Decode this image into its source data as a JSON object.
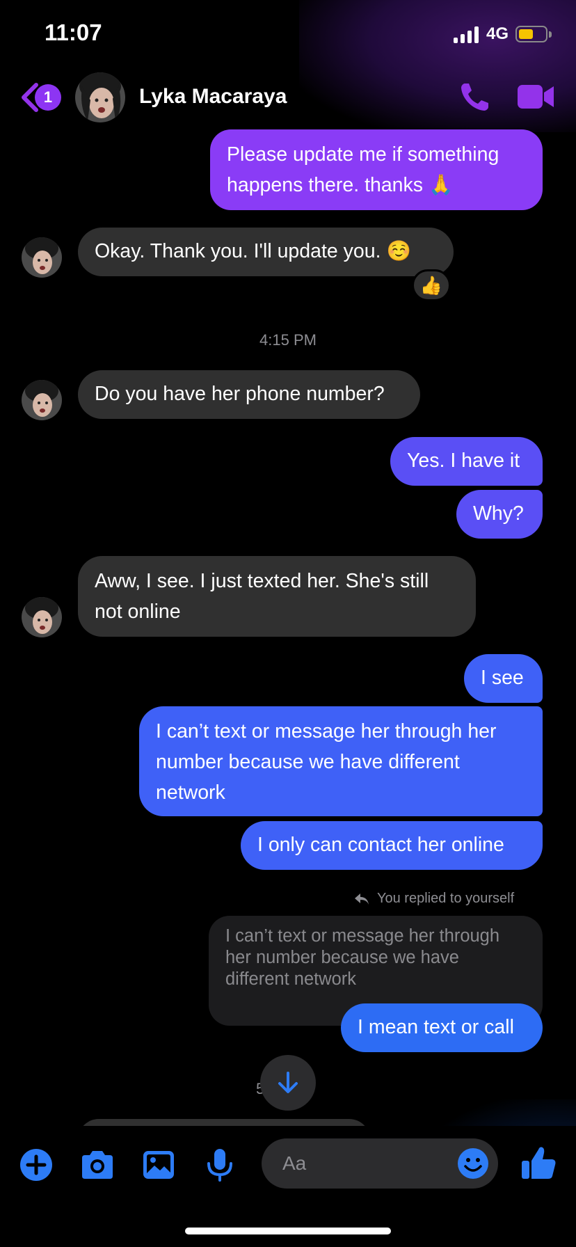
{
  "status_bar": {
    "time": "11:07",
    "network": "4G",
    "battery_level": 0.55
  },
  "header": {
    "unread_count": "1",
    "contact_name": "Lyka Macaraya",
    "accent_color": "#9333ea"
  },
  "messages": [
    {
      "from": "me",
      "text": "Please update me if something happens there. thanks 🙏"
    },
    {
      "from": "contact",
      "text": "Okay. Thank you. I'll update you. ☺️",
      "reaction": "👍"
    },
    {
      "from": "contact",
      "text": "Do you have her phone number?"
    },
    {
      "from": "me",
      "text": "Yes. I have it"
    },
    {
      "from": "me",
      "text": "Why?"
    },
    {
      "from": "contact",
      "text": "Aww, I see. I just texted her. She's still not online"
    },
    {
      "from": "me",
      "text": "I see"
    },
    {
      "from": "me",
      "text": "I can’t text or message her through her number because we have different network"
    },
    {
      "from": "me",
      "text": "I only can contact her online"
    },
    {
      "from": "me",
      "text": "I mean text or call"
    }
  ],
  "timestamp_1": "4:15 PM",
  "reply": {
    "label": "You replied to yourself",
    "quoted_text": "I can’t text or message her through her number because we have different network"
  },
  "peek_timestamp": "5      M",
  "composer": {
    "placeholder": "Aa",
    "icons": [
      "plus-icon",
      "camera-icon",
      "gallery-icon",
      "microphone-icon",
      "emoji-icon",
      "thumbs-up-icon"
    ]
  }
}
